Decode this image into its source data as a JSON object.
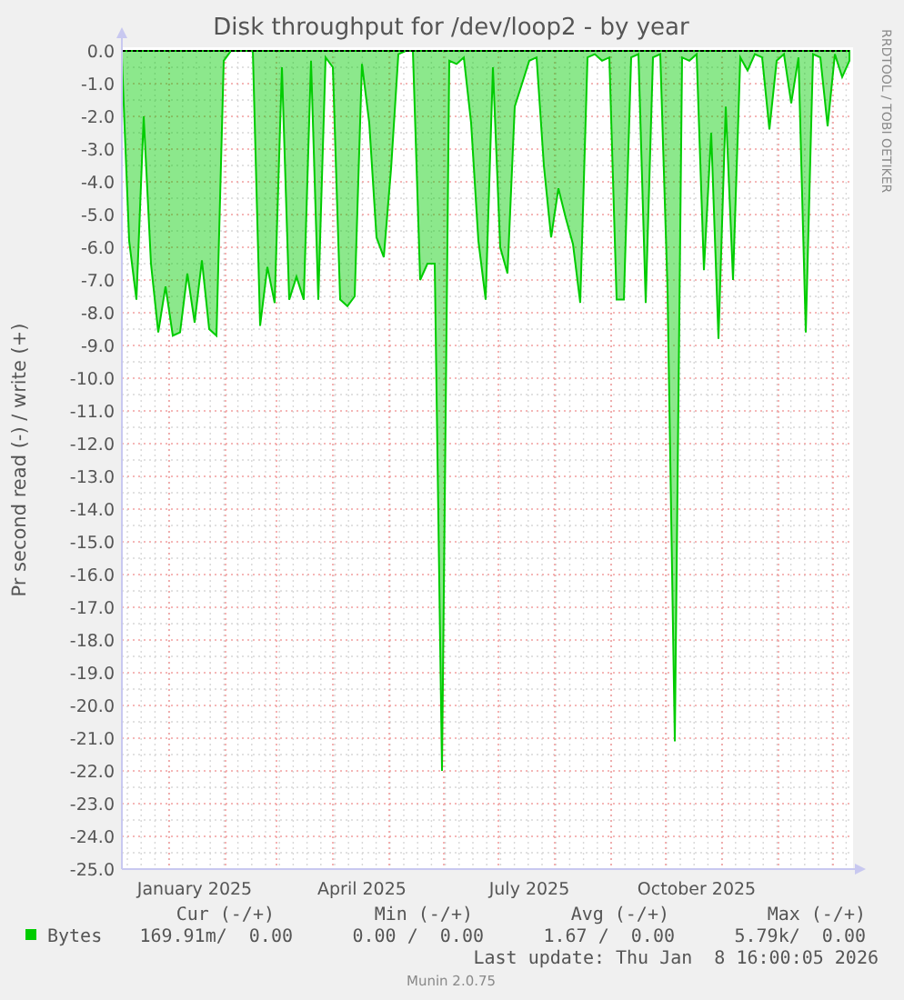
{
  "title": "Disk throughput for /dev/loop2 - by year",
  "watermark": "RRDTOOL / TOBI OETIKER",
  "chart_data": {
    "type": "area",
    "grid": true,
    "ylabel": "Pr second read (-) / write (+)",
    "ylim": [
      -25,
      0
    ],
    "categories": [
      null,
      null,
      null,
      null,
      null,
      null,
      null,
      null,
      null,
      null,
      "January 2025",
      null,
      null,
      null,
      null,
      null,
      null,
      null,
      null,
      null,
      null,
      null,
      null,
      null,
      null,
      null,
      null,
      null,
      null,
      null,
      null,
      null,
      null,
      "April 2025",
      null,
      null,
      null,
      null,
      null,
      null,
      null,
      null,
      null,
      null,
      null,
      null,
      null,
      null,
      null,
      null,
      null,
      null,
      null,
      null,
      null,
      null,
      "July 2025",
      null,
      null,
      null,
      null,
      null,
      null,
      null,
      null,
      null,
      null,
      null,
      null,
      null,
      null,
      null,
      null,
      null,
      null,
      null,
      null,
      null,
      null,
      "October 2025",
      null,
      null,
      null,
      null,
      null,
      null,
      null,
      null,
      null,
      null,
      null,
      null,
      null,
      null,
      null,
      null,
      null,
      null,
      null,
      null,
      null
    ],
    "series": [
      {
        "name": "Bytes",
        "color": "#00cc00",
        "values": [
          -0.2,
          -5.8,
          -7.6,
          -2,
          -6.5,
          -8.6,
          -7.2,
          -8.7,
          -8.6,
          -6.8,
          -8.3,
          -6.4,
          -8.5,
          -8.7,
          -0.3,
          0,
          0,
          0,
          0,
          -8.4,
          -6.6,
          -7.7,
          -0.5,
          -7.6,
          -6.9,
          -7.6,
          -0.3,
          -7.6,
          -0.2,
          -0.5,
          -7.6,
          -7.8,
          -7.5,
          -0.4,
          -2.2,
          -5.7,
          -6.3,
          -3.6,
          -0.1,
          0,
          0,
          -7,
          -6.5,
          -6.5,
          -22,
          -0.3,
          -0.4,
          -0.2,
          -2.2,
          -5.8,
          -7.6,
          -0.5,
          -6,
          -6.8,
          -1.7,
          -1,
          -0.3,
          -0.2,
          -3.5,
          -5.7,
          -4.2,
          -5.1,
          -5.9,
          -7.7,
          -0.2,
          -0.1,
          -0.3,
          -0.2,
          -7.6,
          -7.6,
          -0.2,
          -0.1,
          -7.7,
          -0.2,
          -0.1,
          -7.3,
          -21.1,
          -0.2,
          -0.3,
          -0.1,
          -6.7,
          -2.5,
          -8.8,
          -1.7,
          -7,
          -0.2,
          -0.6,
          -0.1,
          -0.2,
          -2.4,
          -0.3,
          -0.1,
          -1.6,
          -0.2,
          -8.6,
          -0.1,
          -0.2,
          -2.3,
          -0.1,
          -0.8,
          -0.3
        ]
      }
    ],
    "yticks": [
      {
        "value": 0,
        "label": "0.0"
      },
      {
        "value": -1,
        "label": "-1.0"
      },
      {
        "value": -2,
        "label": "-2.0"
      },
      {
        "value": -3,
        "label": "-3.0"
      },
      {
        "value": -4,
        "label": "-4.0"
      },
      {
        "value": -5,
        "label": "-5.0"
      },
      {
        "value": -6,
        "label": "-6.0"
      },
      {
        "value": -7,
        "label": "-7.0"
      },
      {
        "value": -8,
        "label": "-8.0"
      },
      {
        "value": -9,
        "label": "-9.0"
      },
      {
        "value": -10,
        "label": "-10.0"
      },
      {
        "value": -11,
        "label": "-11.0"
      },
      {
        "value": -12,
        "label": "-12.0"
      },
      {
        "value": -13,
        "label": "-13.0"
      },
      {
        "value": -14,
        "label": "-14.0"
      },
      {
        "value": -15,
        "label": "-15.0"
      },
      {
        "value": -16,
        "label": "-16.0"
      },
      {
        "value": -17,
        "label": "-17.0"
      },
      {
        "value": -18,
        "label": "-18.0"
      },
      {
        "value": -19,
        "label": "-19.0"
      },
      {
        "value": -20,
        "label": "-20.0"
      },
      {
        "value": -21,
        "label": "-21.0"
      },
      {
        "value": -22,
        "label": "-22.0"
      },
      {
        "value": -23,
        "label": "-23.0"
      },
      {
        "value": -24,
        "label": "-24.0"
      },
      {
        "value": -25,
        "label": "-25.0"
      }
    ]
  },
  "legend": {
    "columns": [
      "Cur (-/+)",
      "Min (-/+)",
      "Avg (-/+)",
      "Max (-/+)"
    ],
    "rows": [
      {
        "values": [
          "169.91m/  0.00",
          "0.00 /  0.00",
          "1.67 /  0.00",
          "5.79k/  0.00"
        ]
      }
    ],
    "last_update": "Last update: Thu Jan  8 16:00:05 2026"
  },
  "footer": "Munin 2.0.75"
}
